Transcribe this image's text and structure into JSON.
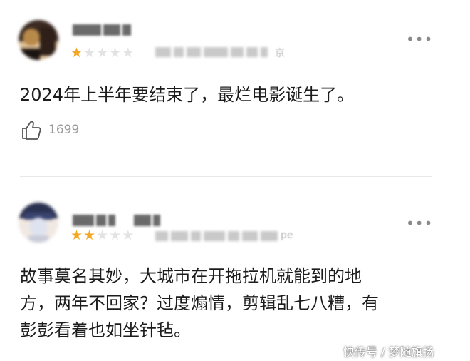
{
  "comments": [
    {
      "rating": 1,
      "max_rating": 5,
      "meta_suffix": "京",
      "text_lines": [
        "2024年上半年要结束了，最烂电影诞生了。"
      ],
      "likes": "1699",
      "avatar_colors": [
        "#3b2a22",
        "#b88a4a",
        "#e0c29a"
      ]
    },
    {
      "rating": 2,
      "max_rating": 5,
      "meta_suffix": "pe",
      "text_lines": [
        "故事莫名其妙，大城市在开拖拉机就能到的地",
        "方，两年不回家？过度煽情，剪辑乱七八糟，有",
        "彭彭看着也如坐针毡。"
      ],
      "avatar_colors": [
        "#2a3150",
        "#dfe3ef",
        "#f1e8e2"
      ]
    }
  ],
  "icons": {
    "more": "more-horizontal-icon",
    "like": "thumbs-up-icon",
    "star": "star-icon"
  },
  "colors": {
    "star_active": "#f5a623",
    "star_inactive": "#e3e3e3",
    "text": "#1c1c1c",
    "muted": "#9a9a9a"
  },
  "watermark": "快传号 / 梦随旗扬"
}
